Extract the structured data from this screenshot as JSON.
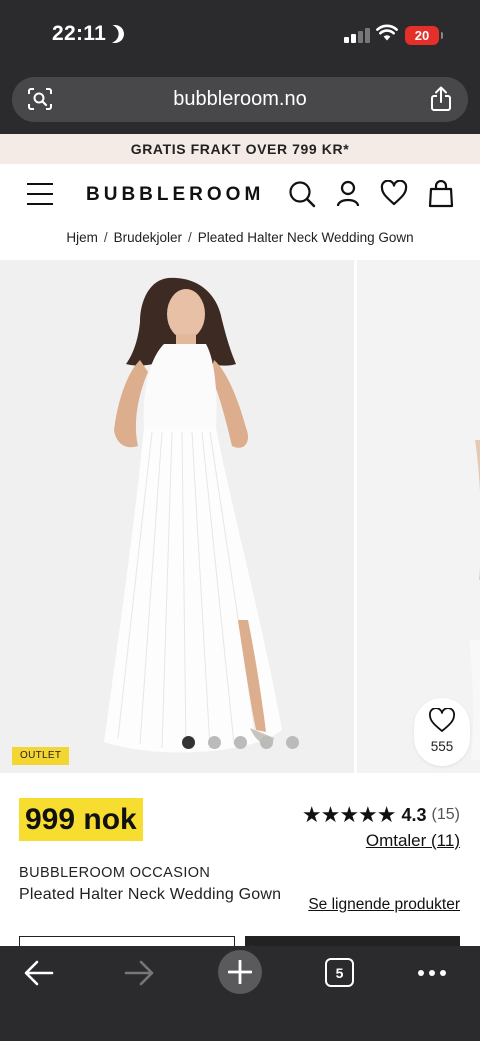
{
  "status": {
    "time": "22:11",
    "battery": "20"
  },
  "browser": {
    "url": "bubbleroom.no",
    "tab_count": "5"
  },
  "promo": {
    "text": "GRATIS FRAKT OVER 799 KR*"
  },
  "header": {
    "logo": "BUBBLEROOM"
  },
  "breadcrumb": {
    "items": [
      "Hjem",
      "Brudekjoler",
      "Pleated Halter Neck Wedding Gown"
    ],
    "separator": "/"
  },
  "gallery": {
    "image_count": 5,
    "active_index": 0,
    "badge": "OUTLET",
    "wishlist_count": "555"
  },
  "product": {
    "price": "999 nok",
    "stars": "★★★★★",
    "rating": "4.3",
    "rating_count": "(15)",
    "reviews_link": "Omtaler (11)",
    "brand": "BUBBLEROOM OCCASION",
    "name": "Pleated Halter Neck Wedding Gown",
    "similar_link": "Se lignende produkter"
  },
  "colors": {
    "promo_bg": "#f5ebe6",
    "price_highlight": "#f7dd2f",
    "outlet_badge": "#f4d632",
    "browser_chrome": "#2b2b2d"
  }
}
